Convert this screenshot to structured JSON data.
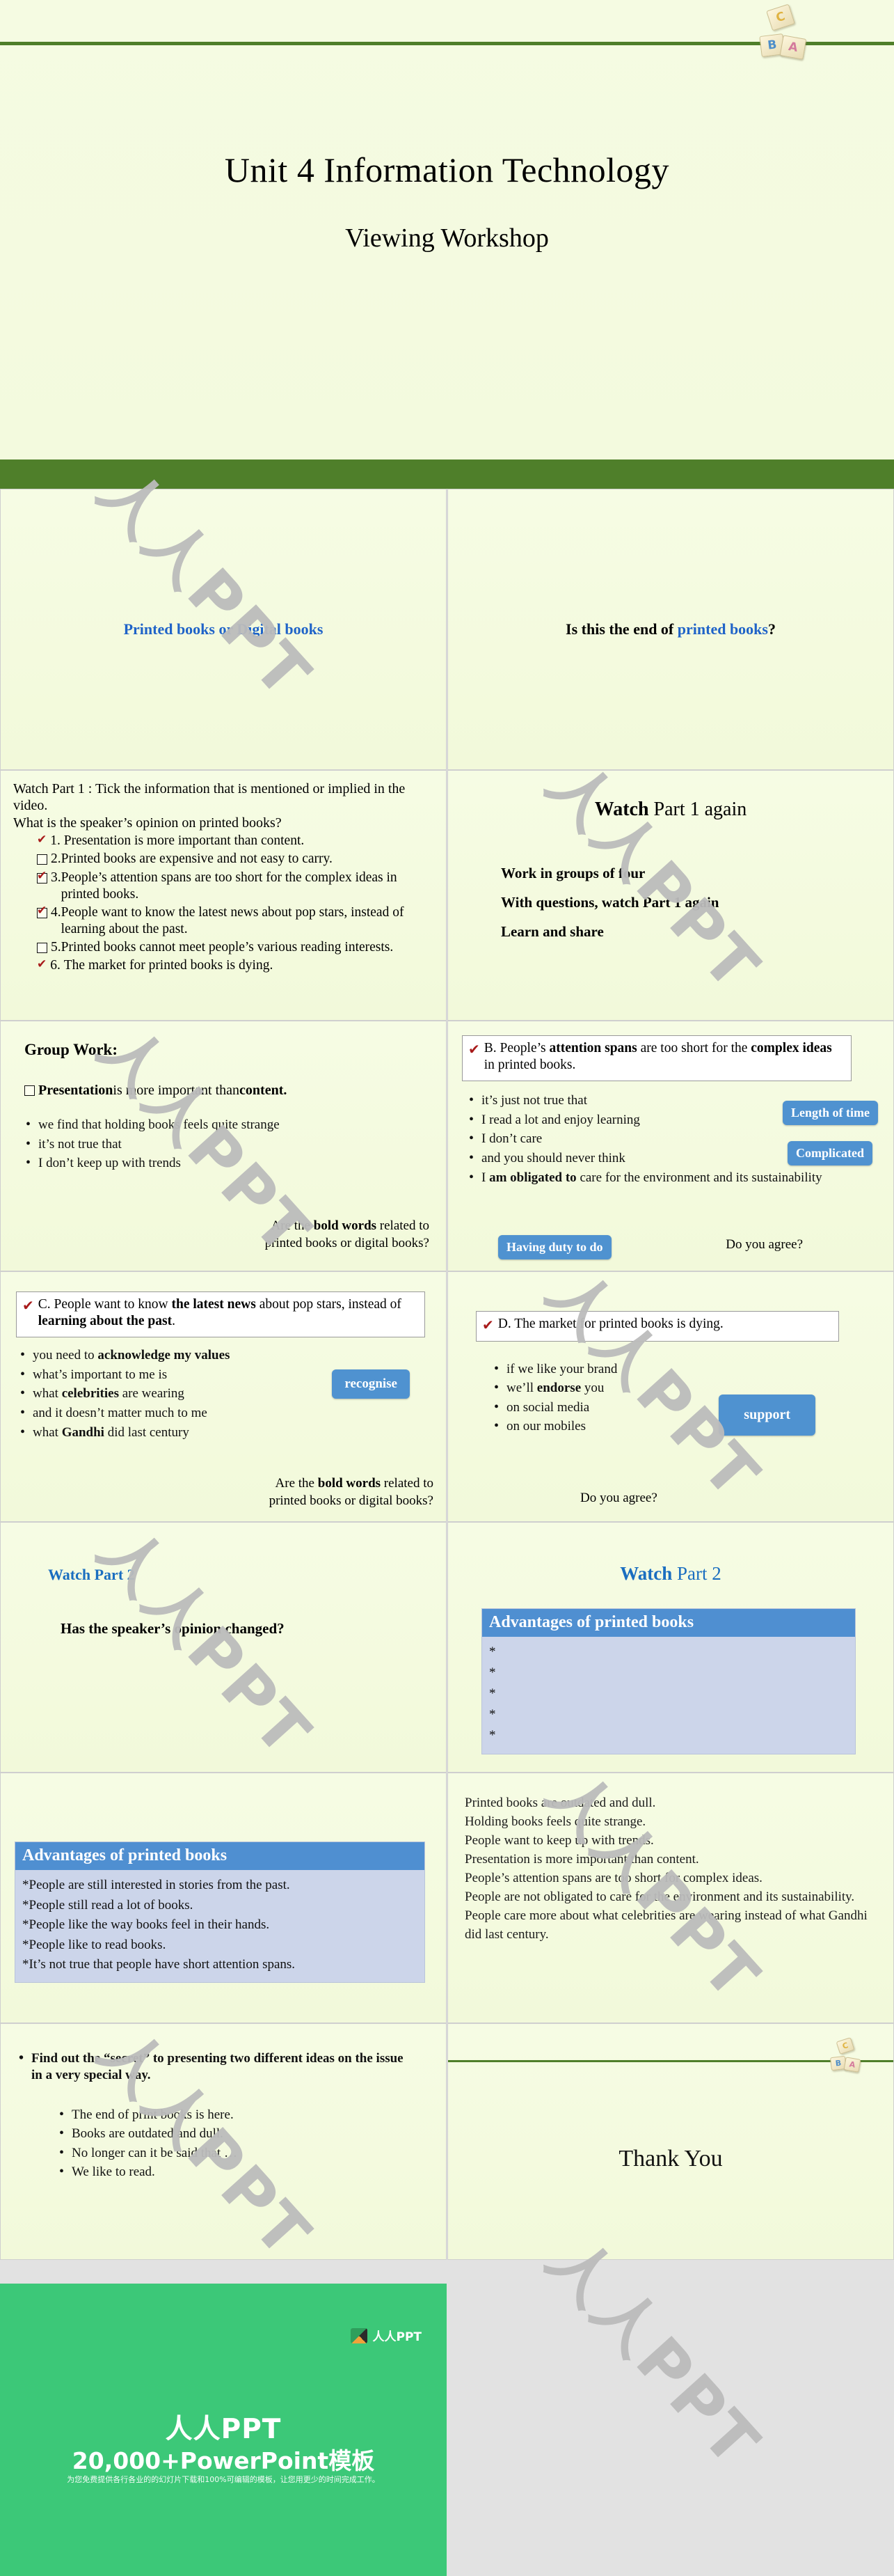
{
  "deck": {
    "title": "Unit 4 Information Technology",
    "subtitle": "Viewing Workshop",
    "decor_blocks": [
      "C",
      "B",
      "A"
    ]
  },
  "slides": {
    "s1": {
      "title": "Printed books or Digital books"
    },
    "s2": {
      "lead": "Is this the end of ",
      "highlight": "printed books",
      "tail": "?"
    },
    "s3": {
      "instruction": "Watch Part 1 : Tick the information that is mentioned or implied in the video.",
      "question": "What is the speaker’s opinion on printed books?",
      "items": [
        {
          "num": "1.",
          "text": "Presentation is more important than content.",
          "state": "tick-plain"
        },
        {
          "num": "2.",
          "text": "Printed books are expensive and not easy to carry.",
          "state": "empty"
        },
        {
          "num": "3.",
          "text": "People’s attention spans are too short for the complex ideas in printed books.",
          "state": "checked"
        },
        {
          "num": "4.",
          "text": "People want to know the latest news about pop stars, instead of learning about the past.",
          "state": "checked"
        },
        {
          "num": "5.",
          "text": "Printed books cannot meet people’s various reading interests.",
          "state": "empty"
        },
        {
          "num": "6.",
          "text": "The market for printed books is dying.",
          "state": "tick-plain"
        }
      ]
    },
    "s4": {
      "title_bold": "Watch",
      "title_rest": " Part 1  again",
      "lines": [
        "Work in groups of four",
        "With questions, watch Part 1 again",
        "Learn and share"
      ]
    },
    "s5": {
      "heading": "Group Work:",
      "statement_a": "Presentation",
      "statement_b": " is more important than ",
      "statement_c": "content.",
      "bullets": [
        "we find that holding books feels quite strange",
        "it’s not true that",
        "I don’t keep up with trends"
      ],
      "prompt_1": "Are the ",
      "prompt_bold": "bold words",
      "prompt_2": " related to",
      "prompt_3": "printed books or digital books?"
    },
    "s6": {
      "letter": "B. People’s ",
      "stmt_bold_1": "attention spans",
      "stmt_mid": " are too short for the ",
      "stmt_bold_2": "complex ideas",
      "stmt_end": " in printed books.",
      "bullets": [
        "it’s just not true that",
        "I read a lot and enjoy learning",
        "I don’t care",
        "and you should never think"
      ],
      "last_bullet_pre": "I ",
      "last_bullet_bold": "am obligated to",
      "last_bullet_post": " care for the environment and its sustainability",
      "pill_1": "Length of time",
      "pill_2": "Complicated",
      "pill_3": "Having duty to do",
      "agree": "Do you agree?"
    },
    "s7": {
      "stmt_pre": "C. People want to know ",
      "stmt_bold_1": "the latest news",
      "stmt_mid": " about pop stars, instead of ",
      "stmt_bold_2": "learning about the past",
      "stmt_end": ".",
      "bullets": [
        {
          "pre": "you need to ",
          "bold": "acknowledge my values",
          "post": ""
        },
        {
          "pre": "what’s important to me is",
          "bold": "",
          "post": ""
        },
        {
          "pre": "what ",
          "bold": "celebrities",
          "post": " are wearing"
        },
        {
          "pre": "and it doesn’t matter much to me",
          "bold": "",
          "post": ""
        },
        {
          "pre": "what ",
          "bold": "Gandhi",
          "post": " did last century"
        }
      ],
      "pill": "recognise",
      "prompt_1": "Are the ",
      "prompt_bold": "bold words",
      "prompt_2": " related to",
      "prompt_3": "printed books or digital books?"
    },
    "s8": {
      "statement": "D. The market for printed books is dying.",
      "bullets": [
        {
          "pre": "if we like your brand",
          "bold": "",
          "post": ""
        },
        {
          "pre": "we’ll ",
          "bold": "endorse",
          "post": " you"
        },
        {
          "pre": "on social media",
          "bold": "",
          "post": ""
        },
        {
          "pre": "on our mobiles",
          "bold": "",
          "post": ""
        }
      ],
      "pill": "support",
      "agree": "Do you agree?"
    },
    "s9": {
      "title": "Watch Part 2",
      "question": "Has the speaker’s opinion changed?"
    },
    "s10": {
      "title_bold": "Watch",
      "title_rest": " Part 2",
      "table_header": "Advantages of printed books",
      "blank_rows": [
        "*",
        "*",
        "*",
        "*",
        "*"
      ]
    },
    "s11": {
      "table_header": "Advantages of printed books",
      "rows": [
        "*People are still interested in stories from the past.",
        "*People still read a lot of books.",
        "*People like the way books feel in their hands.",
        "*People like to read books.",
        "*It’s not true that people have short attention spans."
      ]
    },
    "s12": {
      "lines": [
        "Printed books are outdated and dull.",
        "Holding books feels quite strange.",
        "People want to keep up with trends.",
        "Presentation is more important than content.",
        "People’s attention spans are too short for complex ideas.",
        "People are not obligated to care for the environment and its sustainability.",
        "People care more about what celebrities are wearing instead of what Gandhi did last century."
      ]
    },
    "s13": {
      "heading": "Find out the “secret” to presenting two different ideas on the issue in a very special way.",
      "bullets": [
        "The end of print books is here.",
        "Books are outdated and dull.",
        "No longer can it be said that …",
        "We like to read."
      ]
    },
    "s14": {
      "text": "Thank You"
    }
  },
  "footer": {
    "logo_text": "人人PPT",
    "title": "人人PPT",
    "subtitle": "20,000+PowerPoint模板",
    "note": "为您免费提供各行各业的的幻灯片下载和100%可编辑的模板，让您用更少的时间完成工作。"
  },
  "watermark": {
    "text": "人人PPT"
  },
  "colors": {
    "band_green": "#4f7f2a",
    "brand_green": "#3cc878",
    "pill_blue": "#4f92d0",
    "table_head_blue": "#4f8fd1",
    "table_body_blue": "#ccd5ea",
    "accent_blue": "#1f63c8",
    "tick_red": "#a81b1b",
    "slide_bg": "#f5fbe2"
  }
}
